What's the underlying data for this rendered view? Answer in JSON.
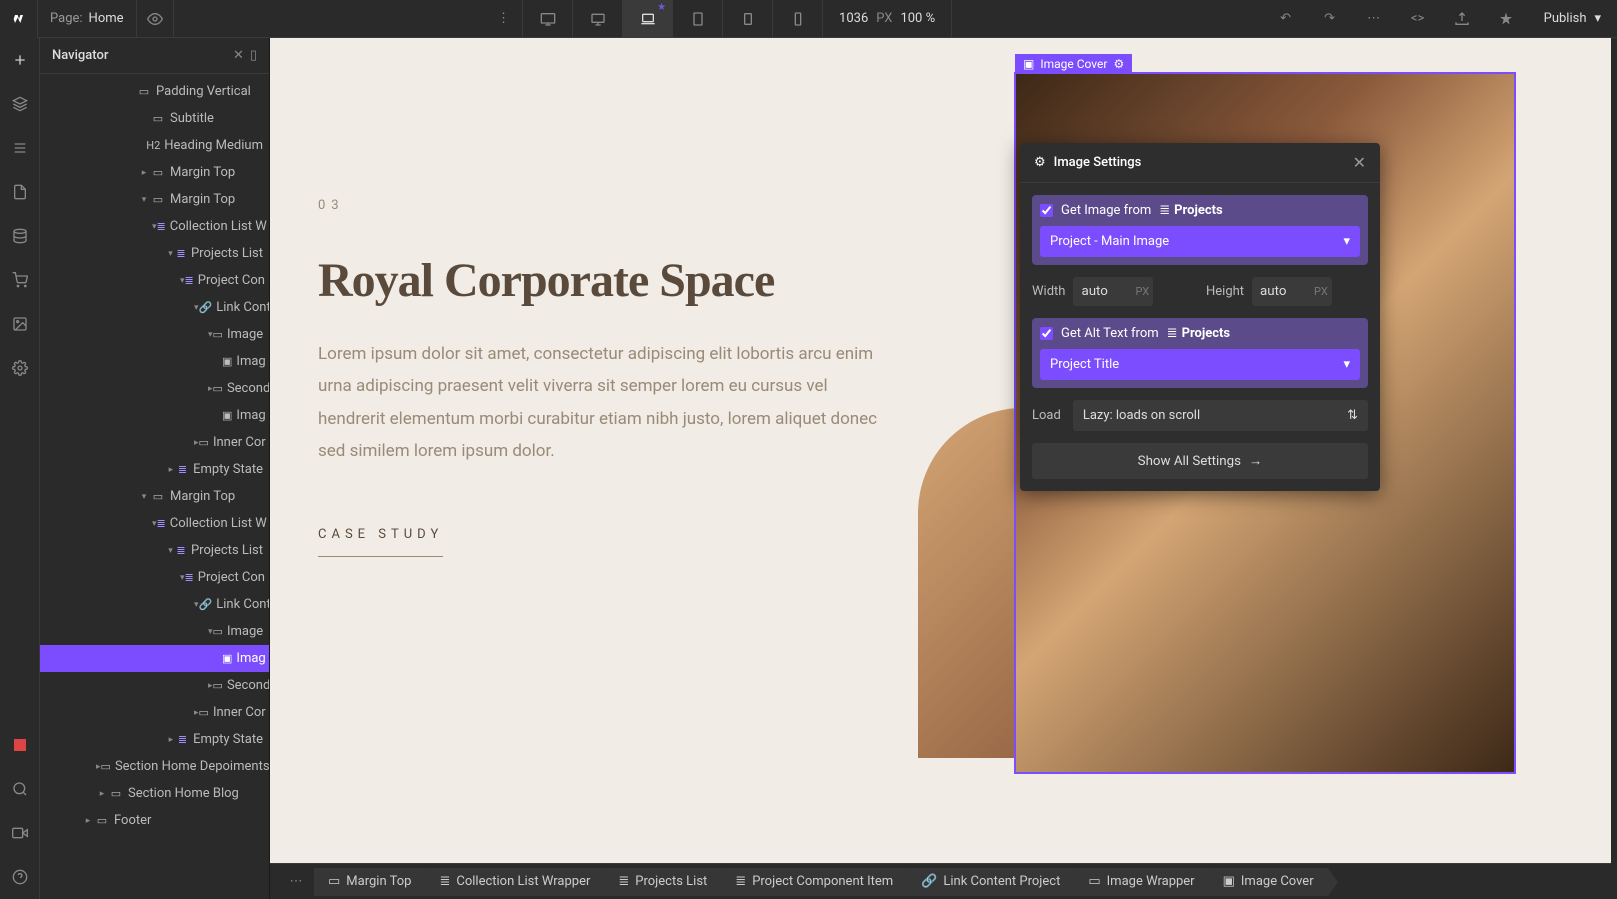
{
  "topbar": {
    "page_label": "Page:",
    "page_name": "Home",
    "width_val": "1036",
    "width_unit": "PX",
    "zoom": "100 %",
    "publish": "Publish"
  },
  "navigator": {
    "title": "Navigator",
    "items": [
      {
        "indent": 6,
        "arrow": "",
        "icon": "▭",
        "label": "Padding Vertical"
      },
      {
        "indent": 7,
        "arrow": "",
        "icon": "▭",
        "label": "Subtitle"
      },
      {
        "indent": 7,
        "arrow": "",
        "icon": "H2",
        "label": "Heading Medium"
      },
      {
        "indent": 7,
        "arrow": "▸",
        "icon": "▭",
        "label": "Margin Top"
      },
      {
        "indent": 7,
        "arrow": "▾",
        "icon": "▭",
        "label": "Margin Top"
      },
      {
        "indent": 8,
        "arrow": "▾",
        "icon": "≣",
        "iconColor": "purple",
        "label": "Collection List W"
      },
      {
        "indent": 9,
        "arrow": "▾",
        "icon": "≣",
        "iconColor": "purple",
        "label": "Projects List"
      },
      {
        "indent": 10,
        "arrow": "▾",
        "icon": "≣",
        "iconColor": "purple",
        "label": "Project Con"
      },
      {
        "indent": 11,
        "arrow": "▾",
        "icon": "🔗",
        "label": "Link Cont"
      },
      {
        "indent": 12,
        "arrow": "▾",
        "icon": "▭",
        "label": "Image"
      },
      {
        "indent": 13,
        "arrow": "",
        "icon": "▣",
        "label": "Imag"
      },
      {
        "indent": 12,
        "arrow": "▸",
        "icon": "▭",
        "label": "Second"
      },
      {
        "indent": 13,
        "arrow": "",
        "icon": "▣",
        "label": "Imag"
      },
      {
        "indent": 11,
        "arrow": "▸",
        "icon": "▭",
        "label": "Inner Cor"
      },
      {
        "indent": 9,
        "arrow": "▸",
        "icon": "≣",
        "iconColor": "purple",
        "label": "Empty State"
      },
      {
        "indent": 7,
        "arrow": "▾",
        "icon": "▭",
        "label": "Margin Top"
      },
      {
        "indent": 8,
        "arrow": "▾",
        "icon": "≣",
        "iconColor": "purple",
        "label": "Collection List W"
      },
      {
        "indent": 9,
        "arrow": "▾",
        "icon": "≣",
        "iconColor": "purple",
        "label": "Projects List"
      },
      {
        "indent": 10,
        "arrow": "▾",
        "icon": "≣",
        "iconColor": "purple",
        "label": "Project Con"
      },
      {
        "indent": 11,
        "arrow": "▾",
        "icon": "🔗",
        "label": "Link Cont"
      },
      {
        "indent": 12,
        "arrow": "▾",
        "icon": "▭",
        "label": "Image"
      },
      {
        "indent": 13,
        "arrow": "",
        "icon": "▣",
        "label": "Imag",
        "selected": true
      },
      {
        "indent": 12,
        "arrow": "▸",
        "icon": "▭",
        "label": "Second"
      },
      {
        "indent": 11,
        "arrow": "▸",
        "icon": "▭",
        "label": "Inner Cor"
      },
      {
        "indent": 9,
        "arrow": "▸",
        "icon": "≣",
        "iconColor": "purple",
        "label": "Empty State"
      },
      {
        "indent": 4,
        "arrow": "▸",
        "icon": "▭",
        "label": "Section Home Depoiments"
      },
      {
        "indent": 4,
        "arrow": "▸",
        "icon": "▭",
        "label": "Section Home Blog"
      },
      {
        "indent": 3,
        "arrow": "▸",
        "icon": "▭",
        "label": "Footer"
      }
    ]
  },
  "canvas": {
    "num": "03",
    "title": "Royal Corporate Space",
    "desc": "Lorem ipsum dolor sit amet, consectetur adipiscing elit lobortis arcu enim urna adipiscing praesent velit viverra sit semper lorem eu cursus vel hendrerit elementum morbi curabitur etiam nibh justo, lorem aliquet donec sed similem lorem ipsum dolor.",
    "cta": "CASE STUDY",
    "img_label": "Image Cover"
  },
  "settings": {
    "title": "Image Settings",
    "get_image_label": "Get Image from",
    "get_image_collection": "Projects",
    "image_field": "Project - Main Image",
    "width_label": "Width",
    "width_val": "auto",
    "width_unit": "PX",
    "height_label": "Height",
    "height_val": "auto",
    "height_unit": "PX",
    "get_alt_label": "Get Alt Text from",
    "get_alt_collection": "Projects",
    "alt_field": "Project Title",
    "load_label": "Load",
    "load_val": "Lazy: loads on scroll",
    "show_all": "Show All Settings"
  },
  "breadcrumbs": [
    {
      "icon": "▭",
      "label": "Margin Top"
    },
    {
      "icon": "≣",
      "label": "Collection List Wrapper"
    },
    {
      "icon": "≣",
      "label": "Projects List"
    },
    {
      "icon": "≣",
      "label": "Project Component Item"
    },
    {
      "icon": "🔗",
      "label": "Link Content Project"
    },
    {
      "icon": "▭",
      "label": "Image Wrapper"
    },
    {
      "icon": "▣",
      "label": "Image Cover"
    }
  ]
}
